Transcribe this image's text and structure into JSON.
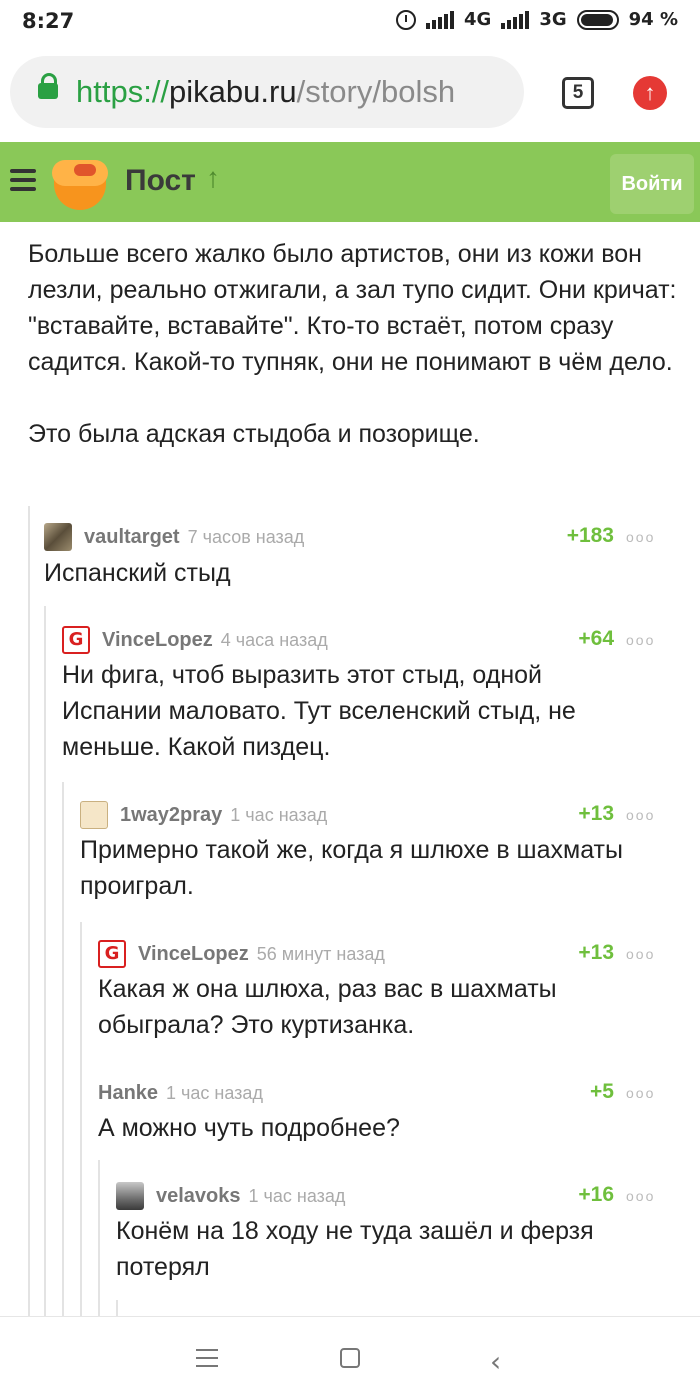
{
  "status_bar": {
    "time": "8:27",
    "network1": "4G",
    "network2": "3G",
    "battery": "94 %"
  },
  "browser": {
    "url_scheme": "https://",
    "url_host": "pikabu.ru",
    "url_path": "/story/bolsh",
    "tab_count": "5"
  },
  "header": {
    "title": "Пост",
    "login_label": "Войти",
    "accent": "#8ac858"
  },
  "post": {
    "paragraphs": [
      "Больше всего жалко было артистов, они из кожи вон лезли, реально отжигали, а зал тупо сидит. Они кричат: \"вставайте, вставайте\". Кто-то встаёт, потом сразу садится. Какой-то тупняк, они не понимают в чём дело.",
      "Это была адская стыдоба и позорище."
    ]
  },
  "comments": [
    {
      "user": "vaultarget",
      "time": "7 часов назад",
      "score": "+183",
      "text": "Испанский стыд"
    },
    {
      "user": "VinceLopez",
      "time": "4 часа назад",
      "score": "+64",
      "text": "Ни фига, чтоб выразить этот стыд, одной Испании маловато. Тут вселенский стыд, не меньше. Какой пиздец."
    },
    {
      "user": "1way2pray",
      "time": "1 час назад",
      "score": "+13",
      "text": "Примерно такой же, когда я шлюхе в шахматы проиграл."
    },
    {
      "user": "VinceLopez",
      "time": "56 минут назад",
      "score": "+13",
      "text": "Какая ж она шлюха, раз вас в шахматы обыграла? Это куртизанка."
    },
    {
      "user": "Hanke",
      "time": "1 час назад",
      "score": "+5",
      "text": "А можно чуть подробнее?"
    },
    {
      "user": "velavoks",
      "time": "1 час назад",
      "score": "+16",
      "text": "Конём на 18 ходу не туда зашёл и ферзя потерял"
    }
  ],
  "icons": {
    "more": "ooo",
    "vince_avatar": "G",
    "up_arrow": "↑",
    "back": "‹"
  }
}
